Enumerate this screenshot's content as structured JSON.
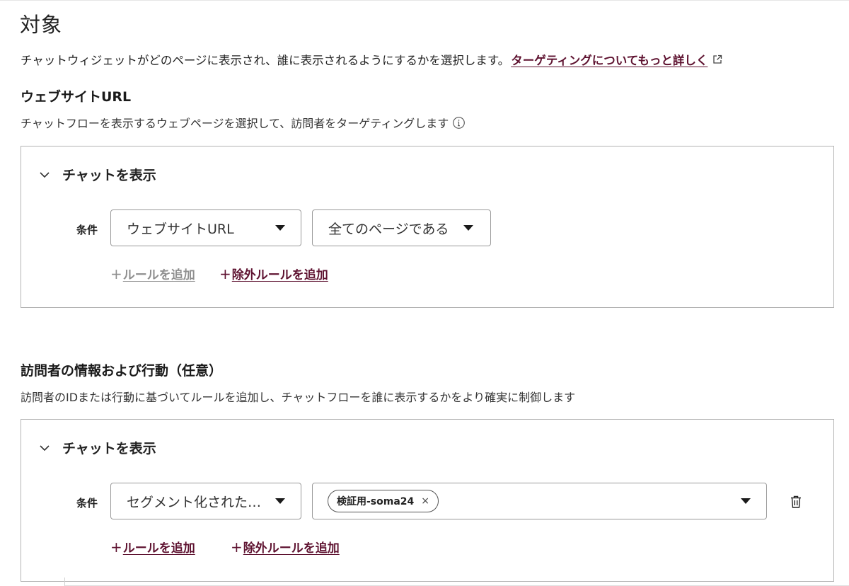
{
  "page": {
    "title": "対象",
    "intro_text": "チャットウィジェットがどのページに表示され、誰に表示されるようにするかを選択します。",
    "intro_link": "ターゲティングについてもっと詳しく",
    "ext_icon": "external-link-icon"
  },
  "colors": {
    "accent": "#5e1230",
    "disabled": "#8f8f8f",
    "border": "#b3b3b3"
  },
  "section1": {
    "title": "ウェブサイトURL",
    "description": "チャットフローを表示するウェブページを選択して、訪問者をターゲティングします",
    "info_icon": "info-icon",
    "panel": {
      "header": "チャットを表示",
      "condition_label": "条件",
      "dropdown1": "ウェブサイトURL",
      "dropdown2": "全てのページである",
      "add_rule_plus": "+",
      "add_rule": "ルールを追加",
      "add_exclude_plus": "+",
      "add_exclude": "除外ルールを追加"
    }
  },
  "section2": {
    "title": "訪問者の情報および行動（任意）",
    "description": "訪問者のIDまたは行動に基づいてルールを追加し、チャットフローを誰に表示するかをより確実に制御します",
    "panel": {
      "header": "チャットを表示",
      "condition_label": "条件",
      "dropdown1": "セグメント化された…",
      "chip": "検証用-soma24",
      "chip_remove": "×",
      "add_rule_plus": "+",
      "add_rule": "ルールを追加",
      "add_exclude_plus": "+",
      "add_exclude": "除外ルールを追加",
      "delete_icon": "trash-icon"
    }
  }
}
